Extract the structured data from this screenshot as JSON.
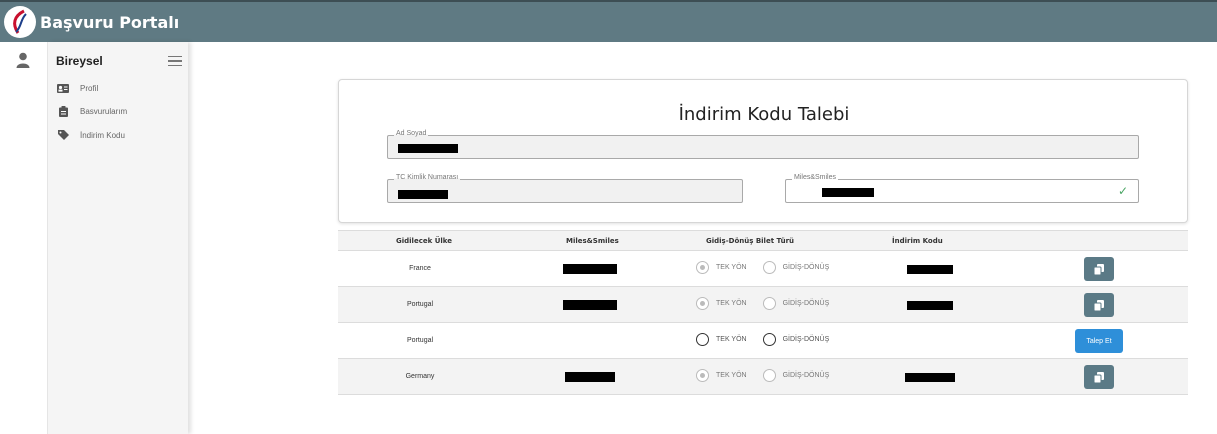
{
  "app": {
    "title": "Başvuru Portalı"
  },
  "sidebar": {
    "title": "Bireysel",
    "items": [
      {
        "label": "Profil",
        "icon": "id-card-icon"
      },
      {
        "label": "Basvurularım",
        "icon": "clipboard-icon"
      },
      {
        "label": "İndirim Kodu",
        "icon": "tag-icon"
      }
    ]
  },
  "form": {
    "title": "İndirim Kodu Talebi",
    "fields": {
      "name": {
        "label": "Ad Soyad",
        "value": "[redacted]"
      },
      "tc": {
        "label": "TC Kimlik Numarası",
        "value": "[redacted]"
      },
      "miles": {
        "label": "Miles&Smiles",
        "value": "[redacted]",
        "verified": true
      }
    }
  },
  "table": {
    "headers": [
      "Gidilecek Ülke",
      "Miles&Smiles",
      "Gidiş-Dönüş Bilet Türü",
      "İndirim Kodu"
    ],
    "option_one_way": "TEK YÖN",
    "option_round_trip": "GİDİŞ-DÖNÜŞ",
    "request_label": "Talep Et",
    "rows": [
      {
        "country": "France",
        "miles_redacted": true,
        "code_redacted": true,
        "selected": "TEK YÖN",
        "action": "copy"
      },
      {
        "country": "Portugal",
        "miles_redacted": true,
        "code_redacted": true,
        "selected": "TEK YÖN",
        "action": "copy"
      },
      {
        "country": "Portugal",
        "miles_redacted": false,
        "code_redacted": false,
        "selected": "",
        "action": "request"
      },
      {
        "country": "Germany",
        "miles_redacted": true,
        "code_redacted": true,
        "selected": "TEK YÖN",
        "action": "copy"
      }
    ]
  },
  "colors": {
    "topbar": "#5f7a83",
    "copy_button": "#5b7a86",
    "request_button": "#2e8fd9",
    "check": "#4aa564"
  }
}
